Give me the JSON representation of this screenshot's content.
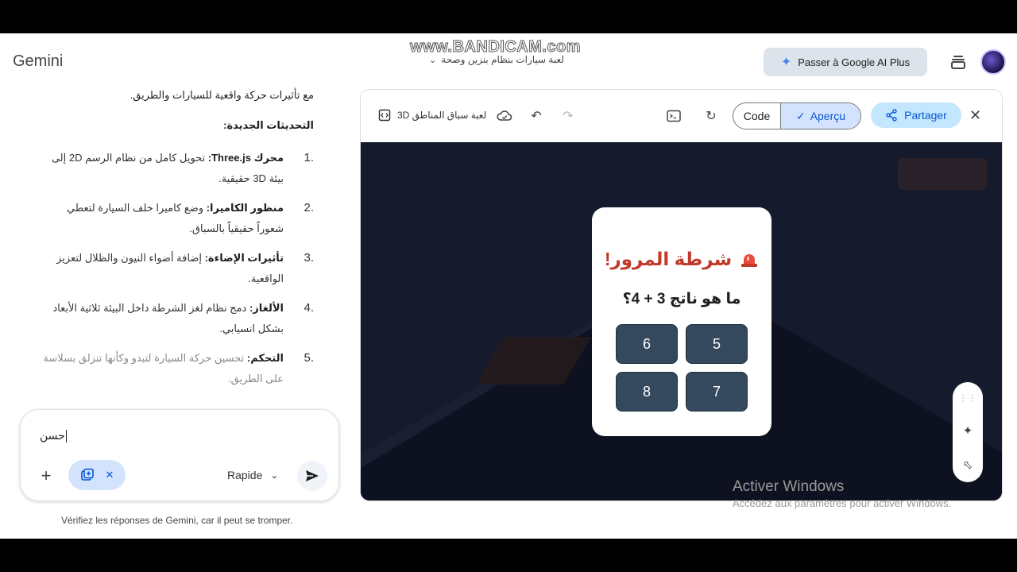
{
  "header": {
    "brand": "Gemini",
    "watermark": "www.BANDICAM.com",
    "conversation_title": "لعبة سيارات بنظام بنزين وصحة",
    "upgrade_label": "Passer à Google AI Plus"
  },
  "chat": {
    "lead": "مع تأثيرات حركة واقعية للسيارات والطريق.",
    "heading": "التحديثات الجديدة:",
    "items": [
      {
        "num": "1.",
        "bold": "محرك Three.js:",
        "text": " تحويل كامل من نظام الرسم 2D إلى بيئة 3D حقيقية."
      },
      {
        "num": "2.",
        "bold": "منظور الكاميرا:",
        "text": " وضع كاميرا خلف السيارة لتعطي شعوراً حقيقياً بالسباق."
      },
      {
        "num": "3.",
        "bold": "تأثيرات الإضاءة:",
        "text": " إضافة أضواء النيون والظلال لتعزيز الواقعية."
      },
      {
        "num": "4.",
        "bold": "الألغاز:",
        "text": " دمج نظام لغز الشرطة داخل البيئة ثلاثية الأبعاد بشكل انسيابي."
      },
      {
        "num": "5.",
        "bold": "التحكم:",
        "text": " تحسين حركة السيارة لتبدو وكأنها تنزلق بسلاسة على الطريق."
      }
    ]
  },
  "composer": {
    "input_text": "حسن",
    "model_label": "Rapide"
  },
  "disclaimer": "Vérifiez les réponses de Gemini, car il peut se tromper.",
  "canvas": {
    "doc_title": "لعبة سباق المناطق 3D",
    "code_label": "Code",
    "preview_label": "Aperçu",
    "share_label": "Partager"
  },
  "game": {
    "modal_title": "شرطة المرور!",
    "question": "ما هو ناتج 3 + 4؟",
    "answers": [
      "6",
      "5",
      "8",
      "7"
    ]
  },
  "system": {
    "activate_title": "Activer Windows",
    "activate_sub": "Accédez aux paramètres pour activer Windows."
  },
  "colors": {
    "accent": "#0b57d0",
    "chip_bg": "#d3e3fd",
    "share_bg": "#c2e7ff",
    "game_bg": "#151a2c",
    "police_red": "#c0392b",
    "answer_bg": "#34495e"
  },
  "icons": [
    "spark-icon",
    "stack-icon",
    "avatar",
    "code-icon",
    "cloud-icon",
    "undo-icon",
    "redo-icon",
    "console-icon",
    "refresh-icon",
    "check-icon",
    "share-icon",
    "close-icon",
    "plus-icon",
    "upload-icon",
    "send-icon",
    "siren-icon",
    "drag-icon",
    "sparkle-edit-icon",
    "select-icon"
  ]
}
